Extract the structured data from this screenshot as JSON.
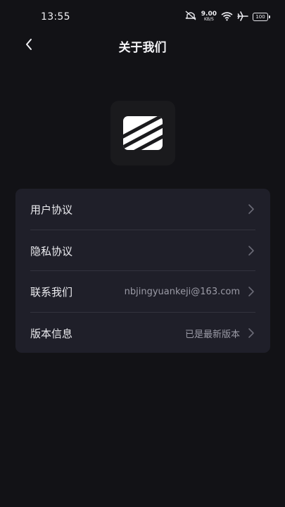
{
  "status_bar": {
    "time": "13:55",
    "net_speed_value": "9.00",
    "net_speed_unit": "KB/S",
    "battery": "100",
    "icons": [
      "mute-icon",
      "wifi-icon",
      "airplane-icon",
      "battery-icon"
    ]
  },
  "header": {
    "title": "关于我们",
    "back_icon": "chevron-left-icon"
  },
  "logo": {
    "icon": "app-logo"
  },
  "menu": {
    "items": [
      {
        "label": "用户协议",
        "value": ""
      },
      {
        "label": "隐私协议",
        "value": ""
      },
      {
        "label": "联系我们",
        "value": "nbjingyuankeji@163.com"
      },
      {
        "label": "版本信息",
        "value": "已是最新版本"
      }
    ]
  },
  "colors": {
    "background": "#121216",
    "card": "#1f1f29",
    "text": "#ececf0",
    "secondary_text": "#9b9ba6"
  }
}
